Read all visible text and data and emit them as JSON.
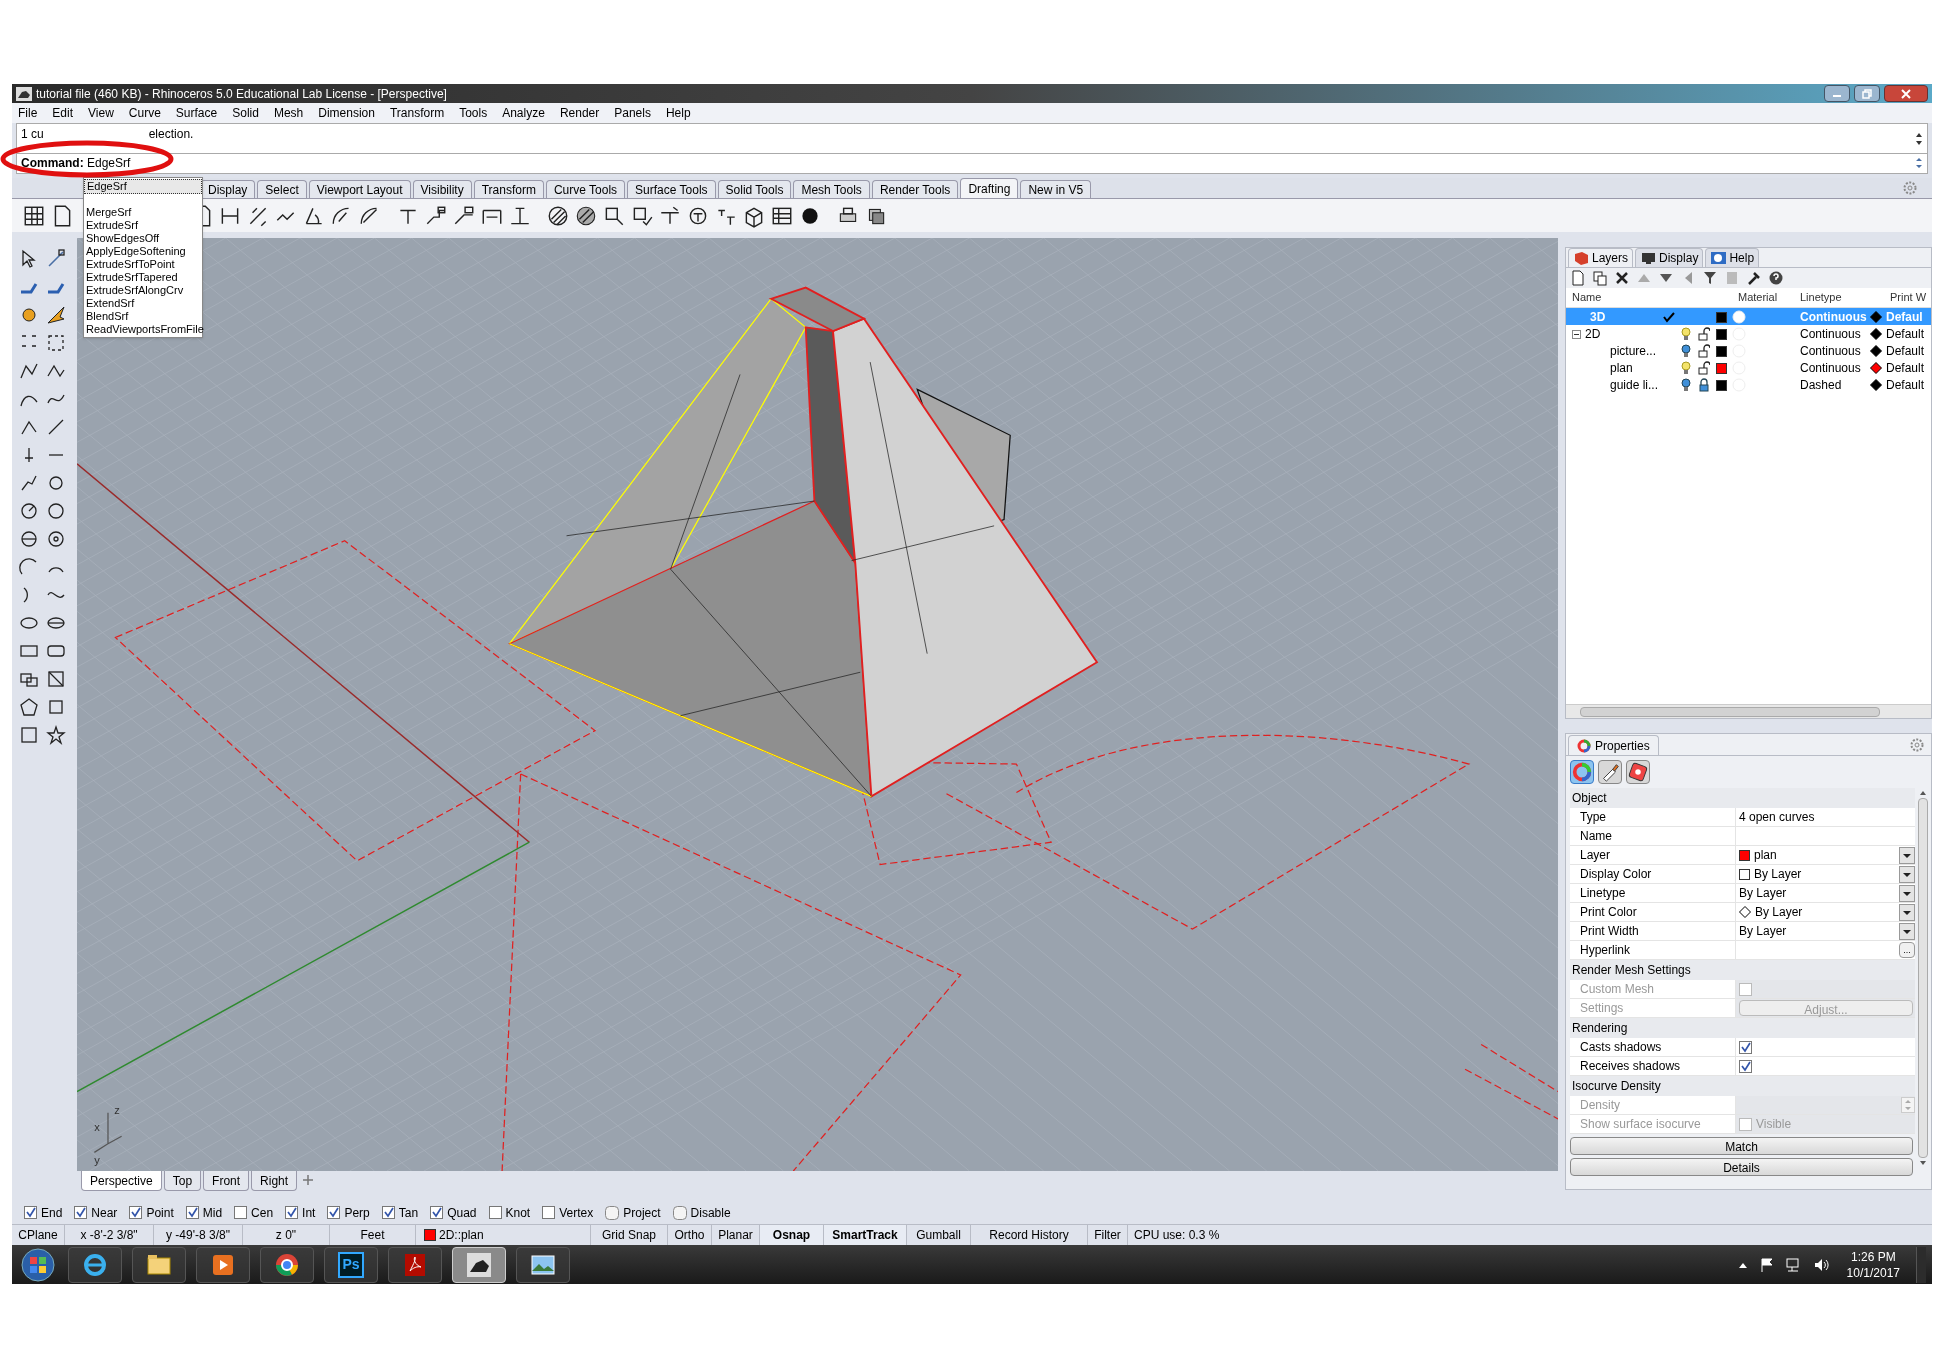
{
  "window": {
    "title": "tutorial file (460 KB) - Rhinoceros 5.0 Educational Lab License - [Perspective]"
  },
  "menu": [
    "File",
    "Edit",
    "View",
    "Curve",
    "Surface",
    "Solid",
    "Mesh",
    "Dimension",
    "Transform",
    "Tools",
    "Analyze",
    "Render",
    "Panels",
    "Help"
  ],
  "command_history": [
    "1 cu",
    "election."
  ],
  "command": {
    "prompt": "Command:",
    "value": "EdgeSrf"
  },
  "autocomplete": [
    {
      "label": "EdgeSrf",
      "selected": true
    },
    {
      "label": "MergeSrf",
      "selected": false
    },
    {
      "label": "ExtrudeSrf",
      "selected": false
    },
    {
      "label": "ShowEdgesOff",
      "selected": false
    },
    {
      "label": "ApplyEdgeSoftening",
      "selected": false
    },
    {
      "label": "ExtrudeSrfToPoint",
      "selected": false
    },
    {
      "label": "ExtrudeSrfTapered",
      "selected": false
    },
    {
      "label": "ExtrudeSrfAlongCrv",
      "selected": false
    },
    {
      "label": "ExtendSrf",
      "selected": false
    },
    {
      "label": "BlendSrf",
      "selected": false
    },
    {
      "label": "ReadViewportsFromFile",
      "selected": false
    }
  ],
  "toolbar_tabs": [
    {
      "label": "Display",
      "selected": false
    },
    {
      "label": "Select",
      "selected": false
    },
    {
      "label": "Viewport Layout",
      "selected": false
    },
    {
      "label": "Visibility",
      "selected": false
    },
    {
      "label": "Transform",
      "selected": false
    },
    {
      "label": "Curve Tools",
      "selected": false
    },
    {
      "label": "Surface Tools",
      "selected": false
    },
    {
      "label": "Solid Tools",
      "selected": false
    },
    {
      "label": "Mesh Tools",
      "selected": false
    },
    {
      "label": "Render Tools",
      "selected": false
    },
    {
      "label": "Drafting",
      "selected": true
    },
    {
      "label": "New in V5",
      "selected": false
    }
  ],
  "viewport": {
    "axis_labels": [
      "z",
      "x",
      "y"
    ],
    "tabs": [
      {
        "label": "Perspective",
        "selected": true
      },
      {
        "label": "Top",
        "selected": false
      },
      {
        "label": "Front",
        "selected": false
      },
      {
        "label": "Right",
        "selected": false
      }
    ]
  },
  "layers_panel": {
    "tabs": [
      {
        "label": "Layers",
        "selected": true
      },
      {
        "label": "Display",
        "selected": false
      },
      {
        "label": "Help",
        "selected": false
      }
    ],
    "columns": {
      "name": "Name",
      "material": "Material",
      "linetype": "Linetype",
      "print_width": "Print W"
    },
    "layers": [
      {
        "name": "3D",
        "selected": true,
        "current": true,
        "color": "#000000",
        "linetype": "Continuous",
        "print_color": {
          "color": "#000000"
        },
        "print_width": "Defaul"
      },
      {
        "name": "2D",
        "selected": false,
        "current": false,
        "visible": true,
        "locked": false,
        "color": "#000000",
        "linetype": "Continuous",
        "print_color": {
          "color": "#000000"
        },
        "print_width": "Default",
        "expanded": true,
        "children": [
          {
            "name": "picture...",
            "selected": false,
            "current": false,
            "visible": false,
            "locked": false,
            "color": "#000000",
            "linetype": "Continuous",
            "print_color": {
              "color": "#000000"
            },
            "print_width": "Default"
          },
          {
            "name": "plan",
            "selected": false,
            "current": false,
            "visible": true,
            "locked": false,
            "color": "#ff0000",
            "linetype": "Continuous",
            "print_color": {
              "color": "#ff0000"
            },
            "print_width": "Default"
          },
          {
            "name": "guide li...",
            "selected": false,
            "current": false,
            "visible": false,
            "locked": true,
            "color": "#000000",
            "linetype": "Dashed",
            "print_color": {
              "color": "#000000"
            },
            "print_width": "Default"
          }
        ]
      }
    ]
  },
  "properties_panel": {
    "title": "Properties",
    "page_buttons": [
      {
        "selected": true
      },
      {
        "selected": false
      },
      {
        "selected": false
      }
    ],
    "sections": [
      {
        "title": "Object",
        "rows": [
          {
            "kind": "text",
            "label": "Type",
            "value": "4 open curves",
            "disabled": false
          },
          {
            "kind": "text",
            "label": "Name",
            "disabled": false
          },
          {
            "kind": "color-dropdown",
            "label": "Layer",
            "value": "plan",
            "color": "#ff0000",
            "disabled": false
          },
          {
            "kind": "color-dropdown",
            "label": "Display Color",
            "value": "By Layer",
            "color": "#ffffff",
            "disabled": false
          },
          {
            "kind": "dropdown",
            "label": "Linetype",
            "value": "By Layer",
            "disabled": false
          },
          {
            "kind": "print-color-dropdown",
            "label": "Print Color",
            "value": "By Layer",
            "color": "#ffffff",
            "disabled": false
          },
          {
            "kind": "dropdown",
            "label": "Print Width",
            "value": "By Layer",
            "disabled": false
          },
          {
            "kind": "ellipsis",
            "label": "Hyperlink",
            "value": "...",
            "disabled": false
          }
        ]
      },
      {
        "title": "Render Mesh Settings",
        "rows": [
          {
            "kind": "checkbox",
            "label": "Custom Mesh",
            "checked": false,
            "disabled": true
          },
          {
            "kind": "button",
            "label": "Settings",
            "value": "Adjust...",
            "disabled": true
          }
        ]
      },
      {
        "title": "Rendering",
        "rows": [
          {
            "kind": "checkbox",
            "label": "Casts shadows",
            "checked": true,
            "disabled": false
          },
          {
            "kind": "checkbox",
            "label": "Receives shadows",
            "checked": true,
            "disabled": false
          }
        ]
      },
      {
        "title": "Isocurve Density",
        "rows": [
          {
            "kind": "spinner",
            "label": "Density",
            "disabled": true
          },
          {
            "kind": "checkbox",
            "label": "Show surface isocurve",
            "checked": false,
            "value": "Visible",
            "disabled": true
          }
        ]
      }
    ],
    "buttons": [
      "Match",
      "Details"
    ]
  },
  "osnaps": [
    {
      "kind": "checkbox",
      "label": "End",
      "checked": true
    },
    {
      "kind": "checkbox",
      "label": "Near",
      "checked": true
    },
    {
      "kind": "checkbox",
      "label": "Point",
      "checked": true
    },
    {
      "kind": "checkbox",
      "label": "Mid",
      "checked": true
    },
    {
      "kind": "checkbox",
      "label": "Cen",
      "checked": false
    },
    {
      "kind": "checkbox",
      "label": "Int",
      "checked": true
    },
    {
      "kind": "checkbox",
      "label": "Perp",
      "checked": true
    },
    {
      "kind": "checkbox",
      "label": "Tan",
      "checked": true
    },
    {
      "kind": "checkbox",
      "label": "Quad",
      "checked": true
    },
    {
      "kind": "checkbox",
      "label": "Knot",
      "checked": false
    },
    {
      "kind": "checkbox",
      "label": "Vertex",
      "checked": false
    },
    {
      "kind": "toggle",
      "label": "Project",
      "checked": false
    },
    {
      "kind": "toggle",
      "label": "Disable",
      "checked": false
    }
  ],
  "status_bar": [
    {
      "kind": "text",
      "text": "CPlane"
    },
    {
      "kind": "text",
      "text": "x -8'-2 3/8\""
    },
    {
      "kind": "text",
      "text": "y -49'-8 3/8\""
    },
    {
      "kind": "text",
      "text": "z 0\""
    },
    {
      "kind": "text",
      "text": "Feet"
    },
    {
      "kind": "layer",
      "text": "2D::plan",
      "color": "#ff0000"
    },
    {
      "kind": "toggle",
      "text": "Grid Snap",
      "on": false
    },
    {
      "kind": "toggle",
      "text": "Ortho",
      "on": false
    },
    {
      "kind": "toggle",
      "text": "Planar",
      "on": false
    },
    {
      "kind": "toggle",
      "text": "Osnap",
      "on": true
    },
    {
      "kind": "toggle",
      "text": "SmartTrack",
      "on": true
    },
    {
      "kind": "toggle",
      "text": "Gumball",
      "on": false
    },
    {
      "kind": "toggle",
      "text": "Record History",
      "on": false
    },
    {
      "kind": "text",
      "text": "Filter"
    },
    {
      "kind": "text",
      "text": "CPU use: 0.3 %"
    }
  ],
  "taskbar": {
    "apps": [
      {
        "kind": "browser-e",
        "active": false
      },
      {
        "kind": "folder",
        "active": false
      },
      {
        "kind": "media",
        "active": false
      },
      {
        "kind": "chrome",
        "active": false
      },
      {
        "kind": "ps",
        "label": "Ps",
        "active": false
      },
      {
        "kind": "pdf",
        "active": false
      },
      {
        "kind": "rhino",
        "active": true
      },
      {
        "kind": "photo",
        "active": false
      }
    ],
    "time": "1:26 PM",
    "date": "10/1/2017"
  }
}
